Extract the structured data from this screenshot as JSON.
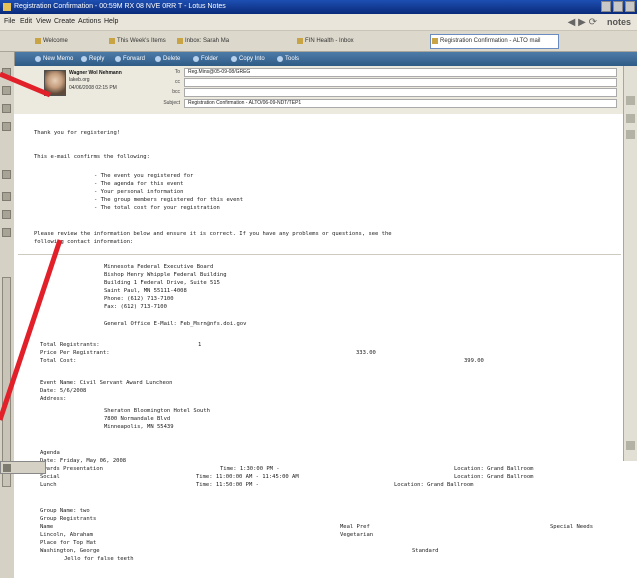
{
  "window": {
    "title": "Registration Confirmation - 00:59M RX 08 NVE 0RR T - Lotus Notes",
    "menus": [
      "File",
      "Edit",
      "View",
      "Create",
      "Actions",
      "Help"
    ],
    "logo": "notes"
  },
  "tabs": [
    {
      "label": "Welcome"
    },
    {
      "label": "This Week's Items"
    },
    {
      "label": "Inbox: Sarah Ma"
    },
    {
      "label": "FIN Health - Inbox"
    },
    {
      "label": "Registration Confirmation - ALTO mail"
    }
  ],
  "toolbar": [
    "New Memo",
    "Reply",
    "Forward",
    "Delete",
    "Folder",
    "Copy Into",
    "Tools"
  ],
  "header": {
    "sender_name": "Wagner Wol Nehmann",
    "sender_sub": "lakeb.org",
    "date": "04/06/2008 02:15 PM",
    "to_label": "To",
    "to_value": "Reg.Mins@05-09-08/GREG",
    "cc_label": "cc",
    "cc_value": "",
    "bcc_label": "bcc",
    "bcc_value": "",
    "subject_label": "Subject",
    "subject_value": "Registration Confirmation - ALTO/06-09-NDT/TEP1"
  },
  "body": {
    "thanks": "Thank you for registering!",
    "intro": "This e-mail confirms the following:",
    "bullets": [
      "- The event you registered for",
      "- The agenda for this event",
      "- Your personal information",
      "- The group members registered for this event",
      "- The total cost for your registration"
    ],
    "review_1": "Please review the information below and ensure it is correct. If you have any problems or questions, see the",
    "review_2": "following contact information:",
    "contact": [
      "Minnesota Federal Executive Board",
      "Bishop Henry Whipple Federal Building",
      "Building 1 Federal Drive, Suite 515",
      "Saint Paul, MN 55111-4008",
      "Phone: (612) 713-7100",
      "Fax: (612) 713-7100",
      "General Office E-Mail: Feb_Msrn@nfs.doi.gov"
    ],
    "total_reg_label": "Total Registrants:",
    "total_reg_value": "1",
    "price_label": "Price Per Registrant:",
    "price_value": "333.00",
    "total_cost_label": "Total Cost:",
    "total_cost_value": "399.00",
    "event_name": "Event Name: Civil Servant Award Luncheon",
    "event_date": "Date: 5/6/2008",
    "address_label": "Address:",
    "address": [
      "Sheraton Bloomington Hotel South",
      "7800 Normandale Blvd",
      "Minneapolis, MN 55439"
    ],
    "agenda_label": "Agenda",
    "agenda_date": "Date: Friday, May 06, 2008",
    "agenda": [
      {
        "item": "Awards Presentation",
        "time": "Time: 1:30:00 PM -",
        "location": "Location: Grand Ballroom"
      },
      {
        "item": "Social",
        "time": "Time: 11:00:00 AM - 11:45:00 AM",
        "location": "Location: Grand Ballroom"
      },
      {
        "item": "Lunch",
        "time": "Time: 11:50:00 PM -",
        "location": "Location: Grand Ballroom"
      }
    ],
    "group_name": "Group Name: two",
    "group_reg": "Group Registrants",
    "group_cols": [
      "Name",
      "Meal Pref",
      "Special Needs"
    ],
    "group_rows": [
      {
        "name": "Lincoln, Abraham",
        "meal": "Vegetarian",
        "needs": ""
      },
      {
        "name": "Place for Top Hat",
        "meal": "",
        "needs": ""
      },
      {
        "name": "Washington, George",
        "meal": "Standard",
        "needs": ""
      },
      {
        "name": "Jello for false teeth",
        "meal": "",
        "needs": ""
      }
    ]
  }
}
